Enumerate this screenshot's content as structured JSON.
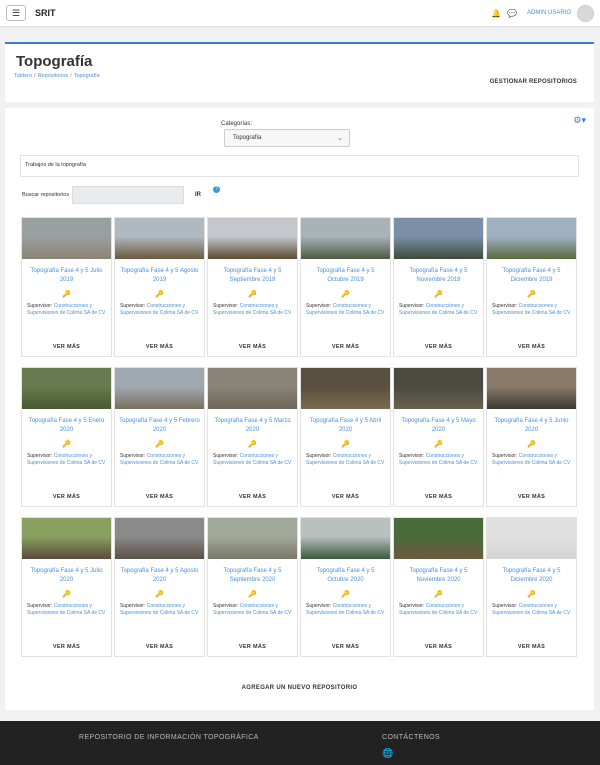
{
  "topbar": {
    "menu_icon": "hamburger-icon",
    "brand": "SRIT",
    "notifications_icon": "bell-icon",
    "messages_icon": "chat-icon",
    "user_name": "ADMIN USARIO"
  },
  "header": {
    "title": "Topografía",
    "breadcrumb": [
      "Tablero",
      "Repositorios",
      "Topografía"
    ],
    "manage_button": "GESTIONAR REPOSITORIOS"
  },
  "filters": {
    "category_label": "Categorías:",
    "category_value": "Topografía",
    "description": "Trabajos de la topografía",
    "search_label": "Buscar repositorios",
    "search_value": "",
    "search_button": "IR"
  },
  "card_common": {
    "supervisor_label": "Supervisor:",
    "supervisor_name": "Construcciones y Supervisiones de Colima SA de CV",
    "more_button": "VER MÁS"
  },
  "cards": [
    {
      "title": "Topografía Fase 4 y 5 Julio 2019",
      "sky": "#9aa0a0",
      "ground": "#8c8474"
    },
    {
      "title": "Topografía Fase 4 y 5 Agosto 2019",
      "sky": "#b0b8c0",
      "ground": "#6b5a3e"
    },
    {
      "title": "Topografía Fase 4 y 5 Septiembre 2019",
      "sky": "#c4c8cc",
      "ground": "#5d4a30"
    },
    {
      "title": "Topografía Fase 4 y 5 Octubre 2019",
      "sky": "#a8b2b8",
      "ground": "#4e5a44"
    },
    {
      "title": "Topografía Fase 4 y 5 Noviembre 2019",
      "sky": "#7a8fa8",
      "ground": "#3e4a3a"
    },
    {
      "title": "Topografía Fase 4 y 5 Diciembre 2019",
      "sky": "#9fb0c2",
      "ground": "#5a6a3e"
    },
    {
      "title": "Topografía Fase 4 y 5 Enero 2020",
      "sky": "#6a7a50",
      "ground": "#4a5a30"
    },
    {
      "title": "Topografía Fase 4 y 5 Febrero 2020",
      "sky": "#a0a8b0",
      "ground": "#7a7060"
    },
    {
      "title": "Topografía Fase 4 y 5 Marzo 2020",
      "sky": "#8a8478",
      "ground": "#6e6658"
    },
    {
      "title": "Topografía Fase 4 y 5 Abril 2020",
      "sky": "#5a5040",
      "ground": "#7a6a50"
    },
    {
      "title": "Topografía Fase 4 y 5 Mayo 2020",
      "sky": "#4a4a40",
      "ground": "#6a6050"
    },
    {
      "title": "Topografía Fase 4 y 5 Junio 2020",
      "sky": "#8a7a6a",
      "ground": "#3a3a30"
    },
    {
      "title": "Topografía Fase 4 y 5 Julio 2020",
      "sky": "#8aa060",
      "ground": "#5a4a3a"
    },
    {
      "title": "Topografía Fase 4 y 5 Agosto 2020",
      "sky": "#8a8a8a",
      "ground": "#5a5048"
    },
    {
      "title": "Topografía Fase 4 y 5 Septiembre 2020",
      "sky": "#a0a898",
      "ground": "#7a7868"
    },
    {
      "title": "Topografía Fase 4 y 5 Octubre 2020",
      "sky": "#b8c0c0",
      "ground": "#3a5a3a"
    },
    {
      "title": "Topografía Fase 4 y 5 Noviembre 2020",
      "sky": "#4a6a3a",
      "ground": "#6a5a40"
    },
    {
      "title": "Topografía Fase 4 y 5 Diciembre 2020",
      "sky": "#e0e0e0",
      "ground": "#d4d4d4"
    }
  ],
  "add_repository": "AGREGAR UN NUEVO REPOSITORIO",
  "footer": {
    "title": "REPOSITORIO DE INFORMACIÓN TOPOGRÁFICA",
    "contact": "CONTÁCTENOS",
    "globe_icon": "globe-icon"
  },
  "colors": {
    "accent": "#3a7bd5",
    "link": "#4a90d9",
    "footer_bg": "#222222"
  }
}
